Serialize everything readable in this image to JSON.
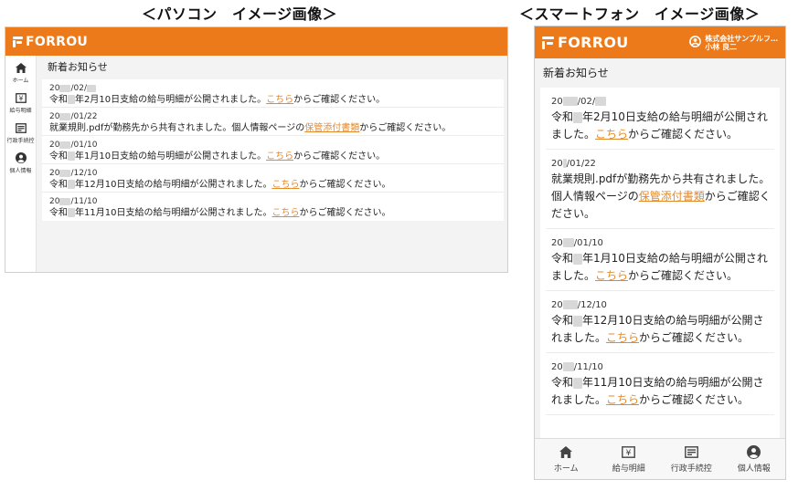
{
  "captions": {
    "pc": "＜パソコン　イメージ画像＞",
    "sp": "＜スマートフォン　イメージ画像＞"
  },
  "brand": {
    "name": "FORROU",
    "color": "#ec7a1a"
  },
  "link_color": "#e58a2b",
  "user": {
    "company": "株式会社サンプルフ…",
    "name": "小林 良二"
  },
  "nav": [
    {
      "label": "ホーム",
      "icon": "home-icon"
    },
    {
      "label": "給与明細",
      "icon": "yen-icon"
    },
    {
      "label": "行政手続控",
      "icon": "document-list-icon"
    },
    {
      "label": "個人情報",
      "icon": "person-icon"
    }
  ],
  "section_title": "新着お知らせ",
  "notices": [
    {
      "date_a": "20",
      "date_b": "/02/",
      "msg_a": "令和",
      "msg_b": "年2月10日支給の給与明細が公開されました。",
      "link": "こちら",
      "msg_c": "からご確認ください。"
    },
    {
      "date_a": "20",
      "date_b": "/01/22",
      "msg_a": "就業規則.pdfが勤務先から共有されました。個人情報ページの",
      "msg_b": "",
      "link": "保管添付書類",
      "msg_c": "からご確認ください。"
    },
    {
      "date_a": "20",
      "date_b": "/01/10",
      "msg_a": "令和",
      "msg_b": "年1月10日支給の給与明細が公開されました。",
      "link": "こちら",
      "msg_c": "からご確認ください。"
    },
    {
      "date_a": "20",
      "date_b": "/12/10",
      "msg_a": "令和",
      "msg_b": "年12月10日支給の給与明細が公開されました。",
      "link": "こちら",
      "msg_c": "からご確認ください。"
    },
    {
      "date_a": "20",
      "date_b": "/11/10",
      "msg_a": "令和",
      "msg_b": "年11月10日支給の給与明細が公開されました。",
      "link": "こちら",
      "msg_c": "からご確認ください。"
    }
  ]
}
